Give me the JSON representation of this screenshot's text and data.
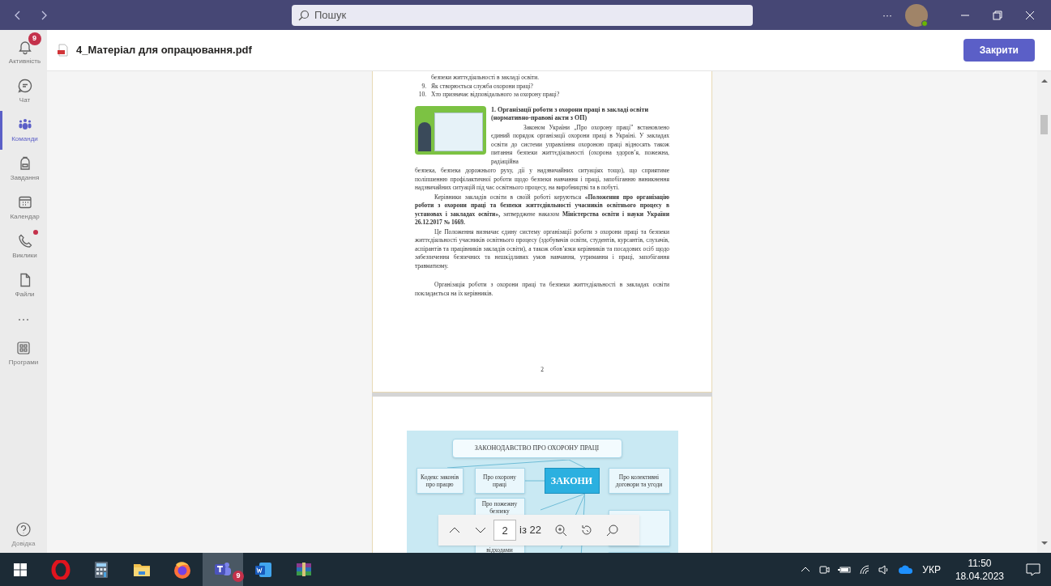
{
  "titlebar": {
    "search": {
      "placeholder": "Пошук"
    },
    "more": "···"
  },
  "sidebar": {
    "items": [
      {
        "label": "Активність",
        "selected": false,
        "badge": "9",
        "dot": false
      },
      {
        "label": "Чат",
        "selected": false,
        "dot": false
      },
      {
        "label": "Команди",
        "selected": true,
        "dot": false
      },
      {
        "label": "Завдання",
        "selected": false,
        "dot": false
      },
      {
        "label": "Календар",
        "selected": false,
        "dot": false
      },
      {
        "label": "Виклики",
        "selected": false,
        "dot": true
      },
      {
        "label": "Файли",
        "selected": false,
        "dot": false
      }
    ],
    "apps": {
      "label": "Програми"
    },
    "help": {
      "label": "Довідка"
    }
  },
  "header": {
    "filename": "4_Матеріал для опрацювання.pdf",
    "close_button": "Закрити"
  },
  "document": {
    "page1": {
      "list": [
        {
          "text": "безпеки життєдіяльності в закладі освіти."
        },
        {
          "number": "9.",
          "text": "Як створюється служба охорони праці?"
        },
        {
          "number": "10.",
          "text": "Хто призначає відповідального за охорону праці?"
        }
      ],
      "heading": "1. Організації роботи з охорони  праці в закладі освіти (нормативно-правові акти з ОП)",
      "paragraphs": [
        "Законом України „Про охорону праці” встановлено єдиний порядок організації охорони праці в Україні.  У закладах освіти до системи управління охороною праці відносять також  питання безпеки життєдіяльності (охорона здоров’я, пожежна, радіаційна",
        "безпека, безпека дорожнього руху, дії у надзвичайних ситуаціях тощо), що сприятиме поліпшенню профілактичної роботи щодо безпеки навчання і праці, запобіганню виникнення надзвичайних ситуацій під час освітнього процесу, на виробництві та в побуті.",
        "Керівники закладів освіти в своїй роботі керуються **«Положення про організацію роботи з охорони праці та безпеки життєдіяльності учасників освітнього процесу в установах і закладах освіти»,** затверджене наказом **Міністерства освіти і науки України 26.12.2017 № 1669.**",
        "Це Положення визначає єдину систему організації роботи з охорони праці та безпеки життєдіяльності учасників освітнього процесу (здобувачів освіти, студентів, курсантів, слухачів, аспірантів та працівників закладів освіти), а також обов’язки керівників та посадових осіб щодо забезпечення безпечних та нешкідливих умов навчання, утримання і праці, запобігання травматизму.",
        "Організація роботи з охорони праці та безпеки життєдіяльності в закладах освіти покладається на їх керівників."
      ],
      "page_number": "2"
    },
    "page2": {
      "diagram": {
        "title": "ЗАКОНОДАВСТВО ПРО ОХОРОНУ ПРАЦІ",
        "center": "ЗАКОНИ",
        "boxes": [
          "Кодекс законів про працю",
          "Про охорону праці",
          "Про колективні договори та угоди",
          "Про пожежну безпеку",
          "відходами"
        ]
      }
    }
  },
  "viewer_toolbar": {
    "page_input": "2",
    "page_total": "із 22"
  },
  "taskbar": {
    "apps": [
      {
        "selected": false
      },
      {
        "selected": false
      },
      {
        "selected": false
      },
      {
        "selected": false
      },
      {
        "selected": false
      },
      {
        "selected": true,
        "badge": "9"
      },
      {
        "selected": false
      },
      {
        "selected": false
      }
    ],
    "language": "УКР",
    "time": "11:50",
    "date": "18.04.2023"
  }
}
